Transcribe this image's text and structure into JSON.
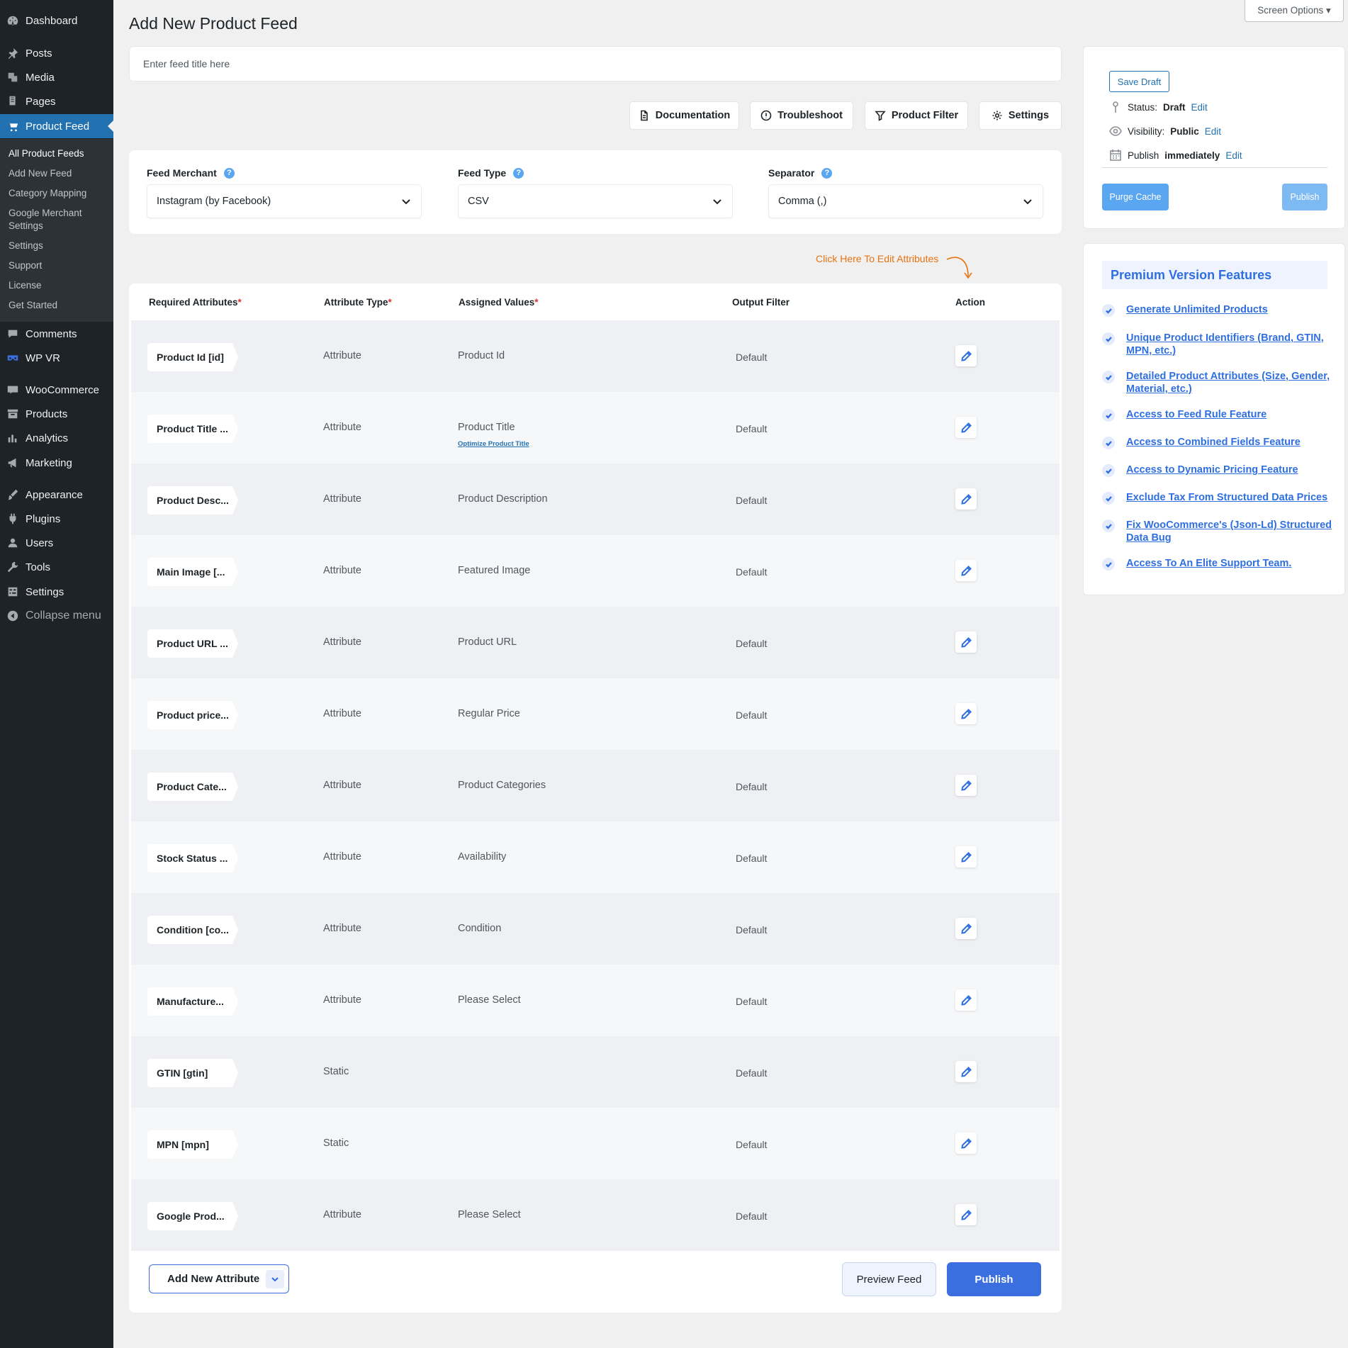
{
  "screen_options": "Screen Options ▾",
  "sidebar": {
    "items": [
      {
        "label": "Dashboard",
        "icon": "dashboard-icon"
      },
      {
        "label": "Posts",
        "icon": "pin-icon"
      },
      {
        "label": "Media",
        "icon": "media-icon"
      },
      {
        "label": "Pages",
        "icon": "pages-icon"
      },
      {
        "label": "Product Feed",
        "icon": "cart-icon"
      },
      {
        "label": "Comments",
        "icon": "comment-icon"
      },
      {
        "label": "WP VR",
        "icon": "vr-icon"
      },
      {
        "label": "WooCommerce",
        "icon": "woo-icon"
      },
      {
        "label": "Products",
        "icon": "archive-icon"
      },
      {
        "label": "Analytics",
        "icon": "bar-chart-icon"
      },
      {
        "label": "Marketing",
        "icon": "megaphone-icon"
      },
      {
        "label": "Appearance",
        "icon": "brush-icon"
      },
      {
        "label": "Plugins",
        "icon": "plugin-icon"
      },
      {
        "label": "Users",
        "icon": "user-icon"
      },
      {
        "label": "Tools",
        "icon": "wrench-icon"
      },
      {
        "label": "Settings",
        "icon": "settings-icon"
      },
      {
        "label": "Collapse menu",
        "icon": "collapse-icon"
      }
    ],
    "submenu": [
      "All Product Feeds",
      "Add New Feed",
      "Category Mapping",
      "Google Merchant Settings",
      "Settings",
      "Support",
      "License",
      "Get Started"
    ]
  },
  "page": {
    "title": "Add New Product Feed",
    "feed_title_placeholder": "Enter feed title here"
  },
  "toolbar": {
    "documentation": "Documentation",
    "troubleshoot": "Troubleshoot",
    "product_filter": "Product Filter",
    "settings": "Settings"
  },
  "config": {
    "merchant_label": "Feed Merchant",
    "merchant_value": "Instagram (by Facebook)",
    "type_label": "Feed Type",
    "type_value": "CSV",
    "separator_label": "Separator",
    "separator_value": "Comma (,)",
    "help": "?"
  },
  "edit_hint": "Click Here To Edit Attributes",
  "table": {
    "headers": {
      "required": "Required Attributes",
      "type": "Attribute Type",
      "values": "Assigned Values",
      "filter": "Output Filter",
      "action": "Action",
      "asterisk": "*"
    },
    "rows": [
      {
        "attr": "Product Id [id]",
        "type": "Attribute",
        "value": "Product Id",
        "filter": "Default"
      },
      {
        "attr": "Product Title ...",
        "type": "Attribute",
        "value": "Product Title",
        "sub": "Optimize Product Title",
        "filter": "Default"
      },
      {
        "attr": "Product Desc...",
        "type": "Attribute",
        "value": "Product Description",
        "filter": "Default"
      },
      {
        "attr": "Main Image [...",
        "type": "Attribute",
        "value": "Featured Image",
        "filter": "Default"
      },
      {
        "attr": "Product URL ...",
        "type": "Attribute",
        "value": "Product URL",
        "filter": "Default"
      },
      {
        "attr": "Product price...",
        "type": "Attribute",
        "value": "Regular Price",
        "filter": "Default"
      },
      {
        "attr": "Product Cate...",
        "type": "Attribute",
        "value": "Product Categories",
        "filter": "Default"
      },
      {
        "attr": "Stock Status ...",
        "type": "Attribute",
        "value": "Availability",
        "filter": "Default"
      },
      {
        "attr": "Condition [co...",
        "type": "Attribute",
        "value": "Condition",
        "filter": "Default"
      },
      {
        "attr": "Manufacture...",
        "type": "Attribute",
        "value": "Please Select",
        "filter": "Default"
      },
      {
        "attr": "GTIN [gtin]",
        "type": "Static",
        "value": "",
        "filter": "Default"
      },
      {
        "attr": "MPN [mpn]",
        "type": "Static",
        "value": "",
        "filter": "Default"
      },
      {
        "attr": "Google Prod...",
        "type": "Attribute",
        "value": "Please Select",
        "filter": "Default"
      }
    ]
  },
  "footer": {
    "add_attribute": "Add New Attribute",
    "preview": "Preview Feed",
    "publish": "Publish"
  },
  "publish_box": {
    "save_draft": "Save Draft",
    "status_label": "Status:",
    "status_value": "Draft",
    "visibility_label": "Visibility:",
    "visibility_value": "Public",
    "publish_label": "Publish",
    "publish_value": "immediately",
    "edit": "Edit",
    "purge_cache": "Purge Cache",
    "publish": "Publish"
  },
  "premium": {
    "title": "Premium Version Features",
    "features": [
      "Generate Unlimited Products",
      "Unique Product Identifiers (Brand, GTIN, MPN, etc.)",
      "Detailed Product Attributes (Size, Gender, Material, etc.)",
      "Access to Feed Rule Feature",
      "Access to Combined Fields Feature",
      "Access to Dynamic Pricing Feature",
      "Exclude Tax From Structured Data Prices",
      "Fix WooCommerce's (Json-Ld) Structured Data Bug",
      "Access To An Elite Support Team."
    ]
  },
  "colors": {
    "sidebar_bg": "#1d2327",
    "wp_blue": "#2271b1",
    "accent_blue": "#3b6fe0",
    "hint_orange": "#e8730f"
  }
}
